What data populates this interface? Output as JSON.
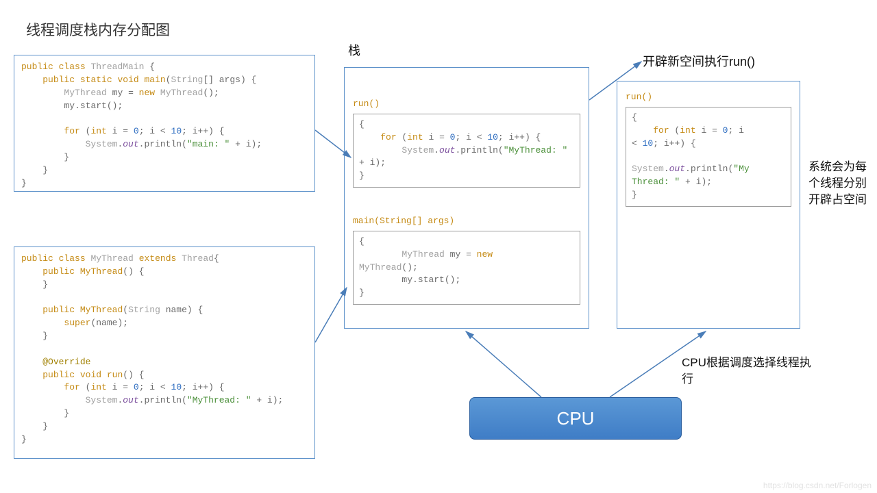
{
  "title": "线程调度栈内存分配图",
  "stackLabel": "栈",
  "newSpaceLabel": "开辟新空间执行run()",
  "rightNote": "系统会为每个线程分别开辟占空间",
  "cpuNote": "CPU根据调度选择线程执行",
  "cpuLabel": "CPU",
  "watermark": "https://blog.csdn.net/Forlogen",
  "codeBox1": {
    "tokens": [
      [
        "kw",
        "public"
      ],
      [
        "punc",
        " "
      ],
      [
        "kw",
        "class"
      ],
      [
        "punc",
        " "
      ],
      [
        "cls",
        "ThreadMain"
      ],
      [
        "punc",
        " {"
      ],
      [
        "nl",
        ""
      ],
      [
        "punc",
        "    "
      ],
      [
        "kw",
        "public"
      ],
      [
        "punc",
        " "
      ],
      [
        "kw",
        "static"
      ],
      [
        "punc",
        " "
      ],
      [
        "kw",
        "void"
      ],
      [
        "punc",
        " "
      ],
      [
        "mth",
        "main"
      ],
      [
        "punc",
        "("
      ],
      [
        "cls",
        "String"
      ],
      [
        "punc",
        "[] "
      ],
      [
        "var",
        "args"
      ],
      [
        "punc",
        ") {"
      ],
      [
        "nl",
        ""
      ],
      [
        "punc",
        "        "
      ],
      [
        "cls",
        "MyThread"
      ],
      [
        "punc",
        " "
      ],
      [
        "var",
        "my"
      ],
      [
        "punc",
        " = "
      ],
      [
        "kw",
        "new"
      ],
      [
        "punc",
        " "
      ],
      [
        "cls",
        "MyThread"
      ],
      [
        "punc",
        "();"
      ],
      [
        "nl",
        ""
      ],
      [
        "punc",
        "        "
      ],
      [
        "var",
        "my"
      ],
      [
        "punc",
        "."
      ],
      [
        "var",
        "start"
      ],
      [
        "punc",
        "();"
      ],
      [
        "nl",
        ""
      ],
      [
        "nl",
        ""
      ],
      [
        "punc",
        "        "
      ],
      [
        "kw",
        "for"
      ],
      [
        "punc",
        " ("
      ],
      [
        "kw",
        "int"
      ],
      [
        "punc",
        " "
      ],
      [
        "var",
        "i"
      ],
      [
        "punc",
        " = "
      ],
      [
        "num",
        "0"
      ],
      [
        "punc",
        "; "
      ],
      [
        "var",
        "i"
      ],
      [
        "punc",
        " < "
      ],
      [
        "num",
        "10"
      ],
      [
        "punc",
        "; "
      ],
      [
        "var",
        "i"
      ],
      [
        "punc",
        "++) {"
      ],
      [
        "nl",
        ""
      ],
      [
        "punc",
        "            "
      ],
      [
        "cls",
        "System"
      ],
      [
        "punc",
        "."
      ],
      [
        "field",
        "out"
      ],
      [
        "punc",
        "."
      ],
      [
        "var",
        "println"
      ],
      [
        "punc",
        "("
      ],
      [
        "str",
        "\"main: \""
      ],
      [
        "punc",
        " + "
      ],
      [
        "var",
        "i"
      ],
      [
        "punc",
        ");"
      ],
      [
        "nl",
        ""
      ],
      [
        "punc",
        "        }"
      ],
      [
        "nl",
        ""
      ],
      [
        "punc",
        "    }"
      ],
      [
        "nl",
        ""
      ],
      [
        "punc",
        "}"
      ]
    ]
  },
  "codeBox2": {
    "tokens": [
      [
        "kw",
        "public"
      ],
      [
        "punc",
        " "
      ],
      [
        "kw",
        "class"
      ],
      [
        "punc",
        " "
      ],
      [
        "cls",
        "MyThread"
      ],
      [
        "punc",
        " "
      ],
      [
        "kw",
        "extends"
      ],
      [
        "punc",
        " "
      ],
      [
        "cls",
        "Thread"
      ],
      [
        "punc",
        "{"
      ],
      [
        "nl",
        ""
      ],
      [
        "punc",
        "    "
      ],
      [
        "kw",
        "public"
      ],
      [
        "punc",
        " "
      ],
      [
        "mth",
        "MyThread"
      ],
      [
        "punc",
        "() {"
      ],
      [
        "nl",
        ""
      ],
      [
        "punc",
        "    }"
      ],
      [
        "nl",
        ""
      ],
      [
        "nl",
        ""
      ],
      [
        "punc",
        "    "
      ],
      [
        "kw",
        "public"
      ],
      [
        "punc",
        " "
      ],
      [
        "mth",
        "MyThread"
      ],
      [
        "punc",
        "("
      ],
      [
        "cls",
        "String"
      ],
      [
        "punc",
        " "
      ],
      [
        "var",
        "name"
      ],
      [
        "punc",
        ") {"
      ],
      [
        "nl",
        ""
      ],
      [
        "punc",
        "        "
      ],
      [
        "kw",
        "super"
      ],
      [
        "punc",
        "("
      ],
      [
        "var",
        "name"
      ],
      [
        "punc",
        ");"
      ],
      [
        "nl",
        ""
      ],
      [
        "punc",
        "    }"
      ],
      [
        "nl",
        ""
      ],
      [
        "nl",
        ""
      ],
      [
        "punc",
        "    "
      ],
      [
        "ann",
        "@Override"
      ],
      [
        "nl",
        ""
      ],
      [
        "punc",
        "    "
      ],
      [
        "kw",
        "public"
      ],
      [
        "punc",
        " "
      ],
      [
        "kw",
        "void"
      ],
      [
        "punc",
        " "
      ],
      [
        "mth",
        "run"
      ],
      [
        "punc",
        "() {"
      ],
      [
        "nl",
        ""
      ],
      [
        "punc",
        "        "
      ],
      [
        "kw",
        "for"
      ],
      [
        "punc",
        " ("
      ],
      [
        "kw",
        "int"
      ],
      [
        "punc",
        " "
      ],
      [
        "var",
        "i"
      ],
      [
        "punc",
        " = "
      ],
      [
        "num",
        "0"
      ],
      [
        "punc",
        "; "
      ],
      [
        "var",
        "i"
      ],
      [
        "punc",
        " < "
      ],
      [
        "num",
        "10"
      ],
      [
        "punc",
        "; "
      ],
      [
        "var",
        "i"
      ],
      [
        "punc",
        "++) {"
      ],
      [
        "nl",
        ""
      ],
      [
        "punc",
        "            "
      ],
      [
        "cls",
        "System"
      ],
      [
        "punc",
        "."
      ],
      [
        "field",
        "out"
      ],
      [
        "punc",
        "."
      ],
      [
        "var",
        "println"
      ],
      [
        "punc",
        "("
      ],
      [
        "str",
        "\"MyThread: \""
      ],
      [
        "punc",
        " + "
      ],
      [
        "var",
        "i"
      ],
      [
        "punc",
        ");"
      ],
      [
        "nl",
        ""
      ],
      [
        "punc",
        "        }"
      ],
      [
        "nl",
        ""
      ],
      [
        "punc",
        "    }"
      ],
      [
        "nl",
        ""
      ],
      [
        "punc",
        "}"
      ]
    ]
  },
  "stack1": {
    "run": {
      "label": "run()",
      "tokens": [
        [
          "punc",
          "{"
        ],
        [
          "nl",
          ""
        ],
        [
          "punc",
          "    "
        ],
        [
          "kw",
          "for"
        ],
        [
          "punc",
          " ("
        ],
        [
          "kw",
          "int"
        ],
        [
          "punc",
          " "
        ],
        [
          "var",
          "i"
        ],
        [
          "punc",
          " = "
        ],
        [
          "num",
          "0"
        ],
        [
          "punc",
          "; "
        ],
        [
          "var",
          "i"
        ],
        [
          "punc",
          " < "
        ],
        [
          "num",
          "10"
        ],
        [
          "punc",
          "; "
        ],
        [
          "var",
          "i"
        ],
        [
          "punc",
          "++) {"
        ],
        [
          "nl",
          ""
        ],
        [
          "punc",
          "        "
        ],
        [
          "cls",
          "System"
        ],
        [
          "punc",
          "."
        ],
        [
          "field",
          "out"
        ],
        [
          "punc",
          "."
        ],
        [
          "var",
          "println"
        ],
        [
          "punc",
          "("
        ],
        [
          "str",
          "\"MyThread: \""
        ],
        [
          "nl",
          ""
        ],
        [
          "punc",
          "+ "
        ],
        [
          "var",
          "i"
        ],
        [
          "punc",
          ");"
        ],
        [
          "nl",
          ""
        ],
        [
          "punc",
          "}"
        ]
      ]
    },
    "main": {
      "label": "main(String[] args)",
      "tokens": [
        [
          "punc",
          "{"
        ],
        [
          "nl",
          ""
        ],
        [
          "punc",
          "        "
        ],
        [
          "cls",
          "MyThread"
        ],
        [
          "punc",
          " "
        ],
        [
          "var",
          "my"
        ],
        [
          "punc",
          " = "
        ],
        [
          "kw",
          "new"
        ],
        [
          "nl",
          ""
        ],
        [
          "cls",
          "MyThread"
        ],
        [
          "punc",
          "();"
        ],
        [
          "nl",
          ""
        ],
        [
          "punc",
          "        "
        ],
        [
          "var",
          "my"
        ],
        [
          "punc",
          "."
        ],
        [
          "var",
          "start"
        ],
        [
          "punc",
          "();"
        ],
        [
          "nl",
          ""
        ],
        [
          "punc",
          "}"
        ]
      ]
    }
  },
  "stack2": {
    "run": {
      "label": "run()",
      "tokens": [
        [
          "punc",
          "{"
        ],
        [
          "nl",
          ""
        ],
        [
          "punc",
          "    "
        ],
        [
          "kw",
          "for"
        ],
        [
          "punc",
          " ("
        ],
        [
          "kw",
          "int"
        ],
        [
          "punc",
          " "
        ],
        [
          "var",
          "i"
        ],
        [
          "punc",
          " = "
        ],
        [
          "num",
          "0"
        ],
        [
          "punc",
          "; "
        ],
        [
          "var",
          "i"
        ],
        [
          "nl",
          ""
        ],
        [
          "punc",
          "< "
        ],
        [
          "num",
          "10"
        ],
        [
          "punc",
          "; "
        ],
        [
          "var",
          "i"
        ],
        [
          "punc",
          "++) {"
        ],
        [
          "nl",
          ""
        ],
        [
          "nl",
          ""
        ],
        [
          "cls",
          "System"
        ],
        [
          "punc",
          "."
        ],
        [
          "field",
          "out"
        ],
        [
          "punc",
          "."
        ],
        [
          "var",
          "println"
        ],
        [
          "punc",
          "("
        ],
        [
          "str",
          "\"My"
        ],
        [
          "nl",
          ""
        ],
        [
          "str",
          "Thread: \""
        ],
        [
          "punc",
          " + "
        ],
        [
          "var",
          "i"
        ],
        [
          "punc",
          ");"
        ],
        [
          "nl",
          ""
        ],
        [
          "punc",
          "}"
        ]
      ]
    }
  }
}
